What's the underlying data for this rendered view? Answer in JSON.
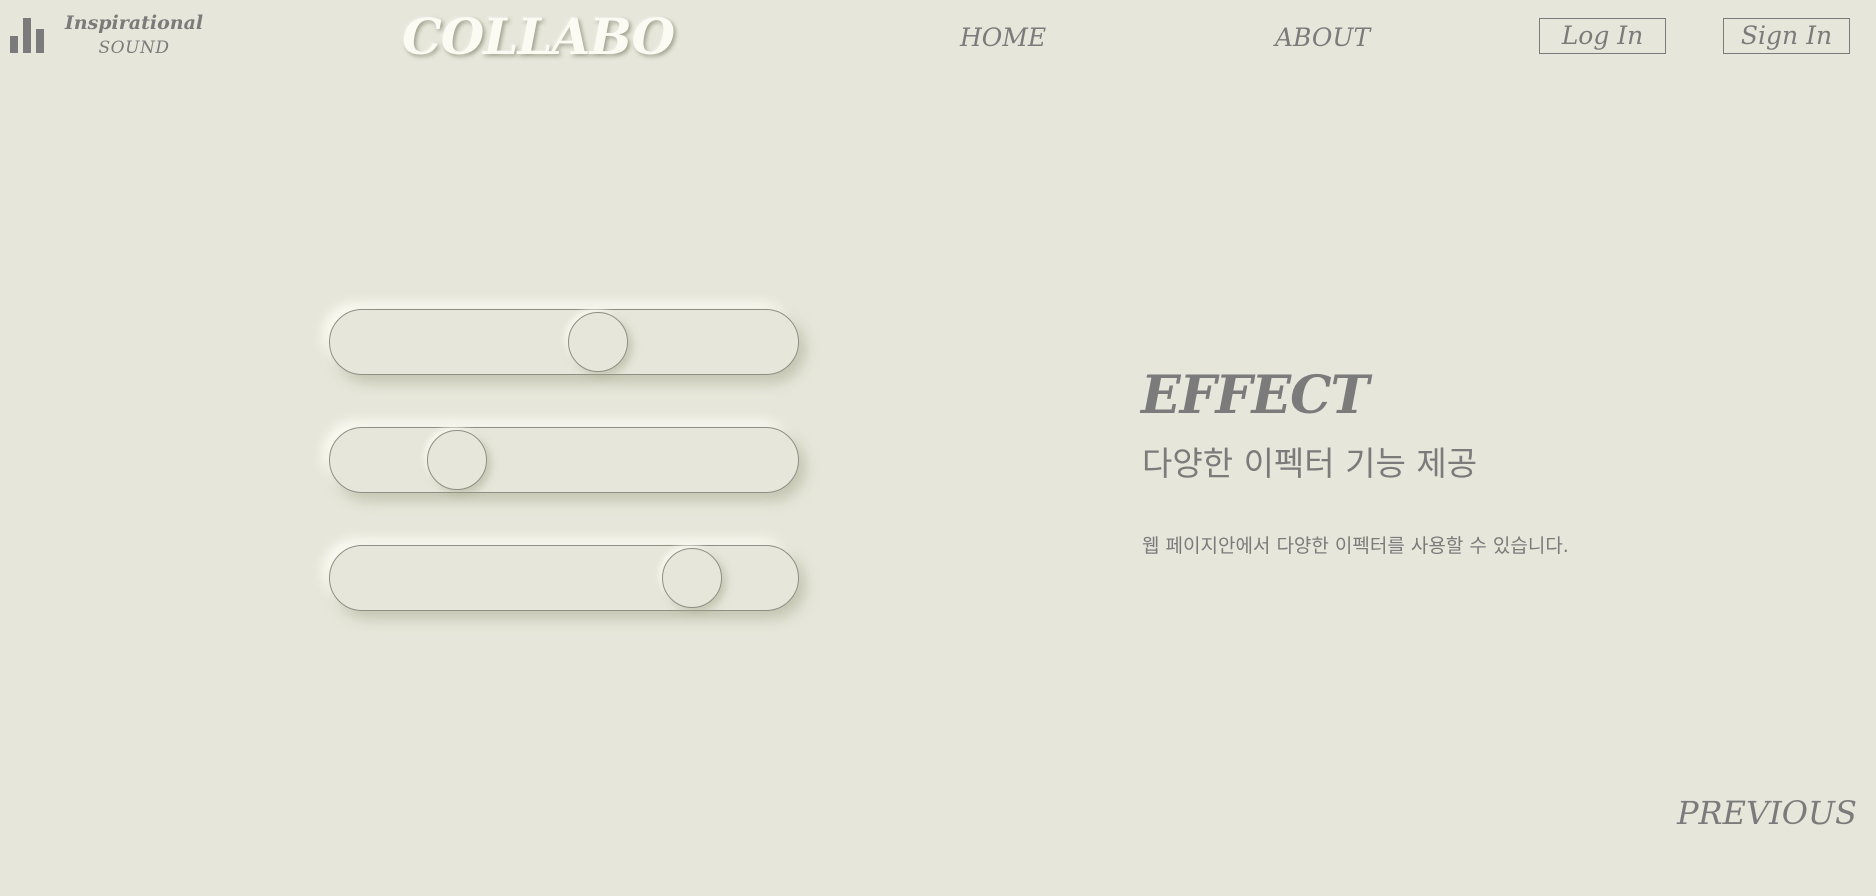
{
  "header": {
    "logo_icon": "bar-chart-icon",
    "brand_top": "Inspirational",
    "brand_bottom": "SOUND",
    "site_title": "COLLABO",
    "nav": {
      "home": "HOME",
      "about": "ABOUT"
    },
    "buttons": {
      "login": "Log In",
      "signin": "Sign In"
    }
  },
  "sliders": [
    {
      "value": 0.57
    },
    {
      "value": 0.27
    },
    {
      "value": 0.77
    }
  ],
  "content": {
    "title": "EFFECT",
    "subtitle": "다양한 이펙터 기능 제공",
    "description": "웹 페이지안에서 다양한 이펙터를 사용할 수 있습니다."
  },
  "footer": {
    "previous": "PREVIOUS"
  },
  "colors": {
    "background": "#e6e6da",
    "text": "#7b7b7b",
    "title_highlight": "#fbfbf4"
  }
}
